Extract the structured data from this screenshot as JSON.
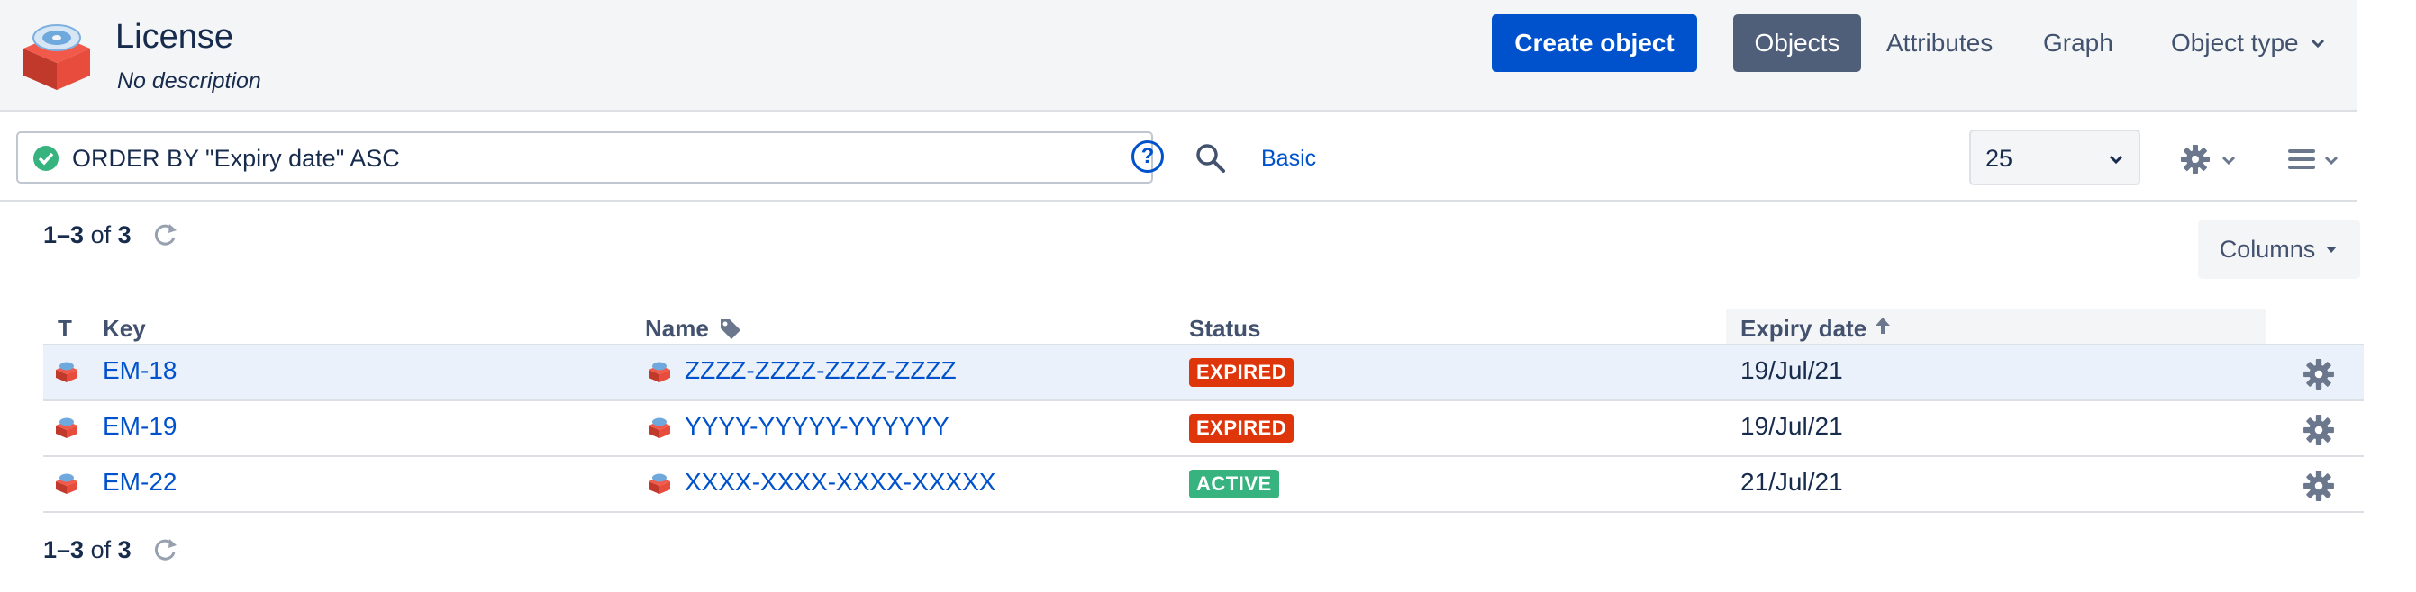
{
  "header": {
    "title": "License",
    "description": "No description",
    "create_button": "Create object",
    "tabs": [
      "Objects",
      "Attributes",
      "Graph",
      "Object type"
    ]
  },
  "search": {
    "query": "ORDER BY \"Expiry date\" ASC",
    "help_label": "?",
    "basic_label": "Basic",
    "page_size": "25"
  },
  "results": {
    "count_top": {
      "range": "1–3",
      "of": "of",
      "total": "3"
    },
    "count_bottom": {
      "range": "1–3",
      "of": "of",
      "total": "3"
    },
    "columns_label": "Columns",
    "headers": {
      "type": "T",
      "key": "Key",
      "name": "Name",
      "status": "Status",
      "expiry": "Expiry date"
    },
    "rows": [
      {
        "key": "EM-18",
        "name": "ZZZZ-ZZZZ-ZZZZ-ZZZZ",
        "status": "EXPIRED",
        "expiry": "19/Jul/21"
      },
      {
        "key": "EM-19",
        "name": "YYYY-YYYYY-YYYYYY",
        "status": "EXPIRED",
        "expiry": "19/Jul/21"
      },
      {
        "key": "EM-22",
        "name": "XXXX-XXXX-XXXX-XXXXX",
        "status": "ACTIVE",
        "expiry": "21/Jul/21"
      }
    ]
  },
  "colors": {
    "primary": "#0052cc",
    "selected_tab": "#505f79",
    "expired": "#de350b",
    "active": "#36b37e",
    "valid": "#36b37e"
  },
  "icons": {
    "object_type": "license-box-icon",
    "valid": "check-circle-icon",
    "help": "question-circle-icon",
    "search": "search-icon",
    "refresh": "refresh-icon",
    "settings": "gear-icon",
    "menu": "hamburger-icon",
    "tag": "tag-icon",
    "sort": "arrow-up-icon"
  }
}
